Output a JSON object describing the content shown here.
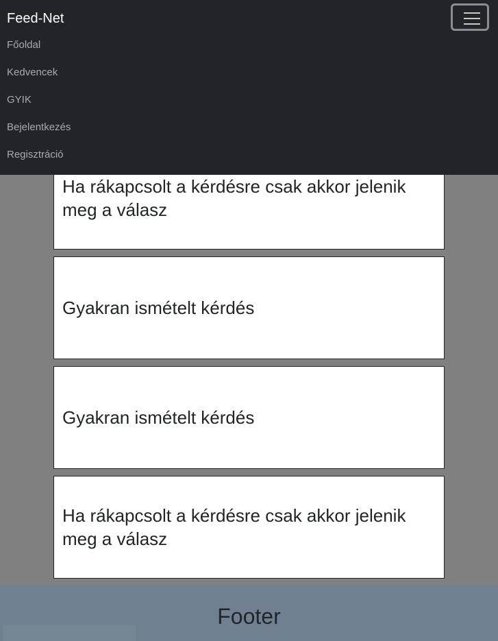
{
  "navbar": {
    "brand": "Feed-Net",
    "toggler_icon": "hamburger-menu-icon",
    "links": [
      {
        "label": "Főoldal"
      },
      {
        "label": "Kedvencek"
      },
      {
        "label": "GYIK"
      },
      {
        "label": "Bejelentkezés"
      },
      {
        "label": "Regisztráció"
      }
    ]
  },
  "faq": {
    "items": [
      {
        "text": "Ha rákapcsolt a kérdésre csak akkor jelenik meg a válasz"
      },
      {
        "text": "Gyakran ismételt kérdés"
      },
      {
        "text": "Gyakran ismételt kérdés"
      },
      {
        "text": "Ha rákapcsolt a kérdésre csak akkor jelenik meg a válasz"
      }
    ]
  },
  "footer": {
    "text": "Footer"
  },
  "colors": {
    "navbar_bg": "#212529",
    "page_bg": "#808080",
    "footer_bg": "#708090",
    "card_bg": "#ffffff"
  }
}
